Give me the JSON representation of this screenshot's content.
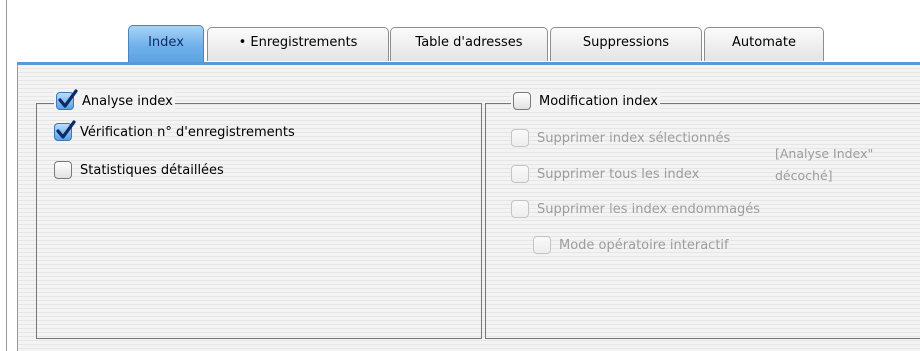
{
  "tabs": [
    {
      "label": "Index",
      "active": true
    },
    {
      "label": "• Enregistrements",
      "active": false
    },
    {
      "label": "Table d'adresses",
      "active": false
    },
    {
      "label": "Suppressions",
      "active": false
    },
    {
      "label": "Automate",
      "active": false
    }
  ],
  "left_group": {
    "title": "Analyse index",
    "title_checked": true,
    "options": [
      {
        "label": "Vérification n° d'enregistrements",
        "checked": true,
        "enabled": true
      },
      {
        "label": "Statistiques détaillées",
        "checked": false,
        "enabled": true
      }
    ]
  },
  "right_group": {
    "title": "Modification index",
    "title_checked": false,
    "options": [
      {
        "label": "Supprimer index sélectionnés",
        "checked": false,
        "enabled": false
      },
      {
        "label": "Supprimer tous les index",
        "checked": false,
        "enabled": false
      },
      {
        "label": "Supprimer les index endommagés",
        "checked": false,
        "enabled": false
      },
      {
        "label": "Mode opératoire interactif",
        "checked": false,
        "enabled": false
      }
    ],
    "note_line1": "[Analyse Index\"",
    "note_line2": "décoché]"
  },
  "colors": {
    "accent": "#5aa2e3",
    "disabled_text": "#9c9c9c",
    "pane_stripe": "#e6e6e6"
  }
}
